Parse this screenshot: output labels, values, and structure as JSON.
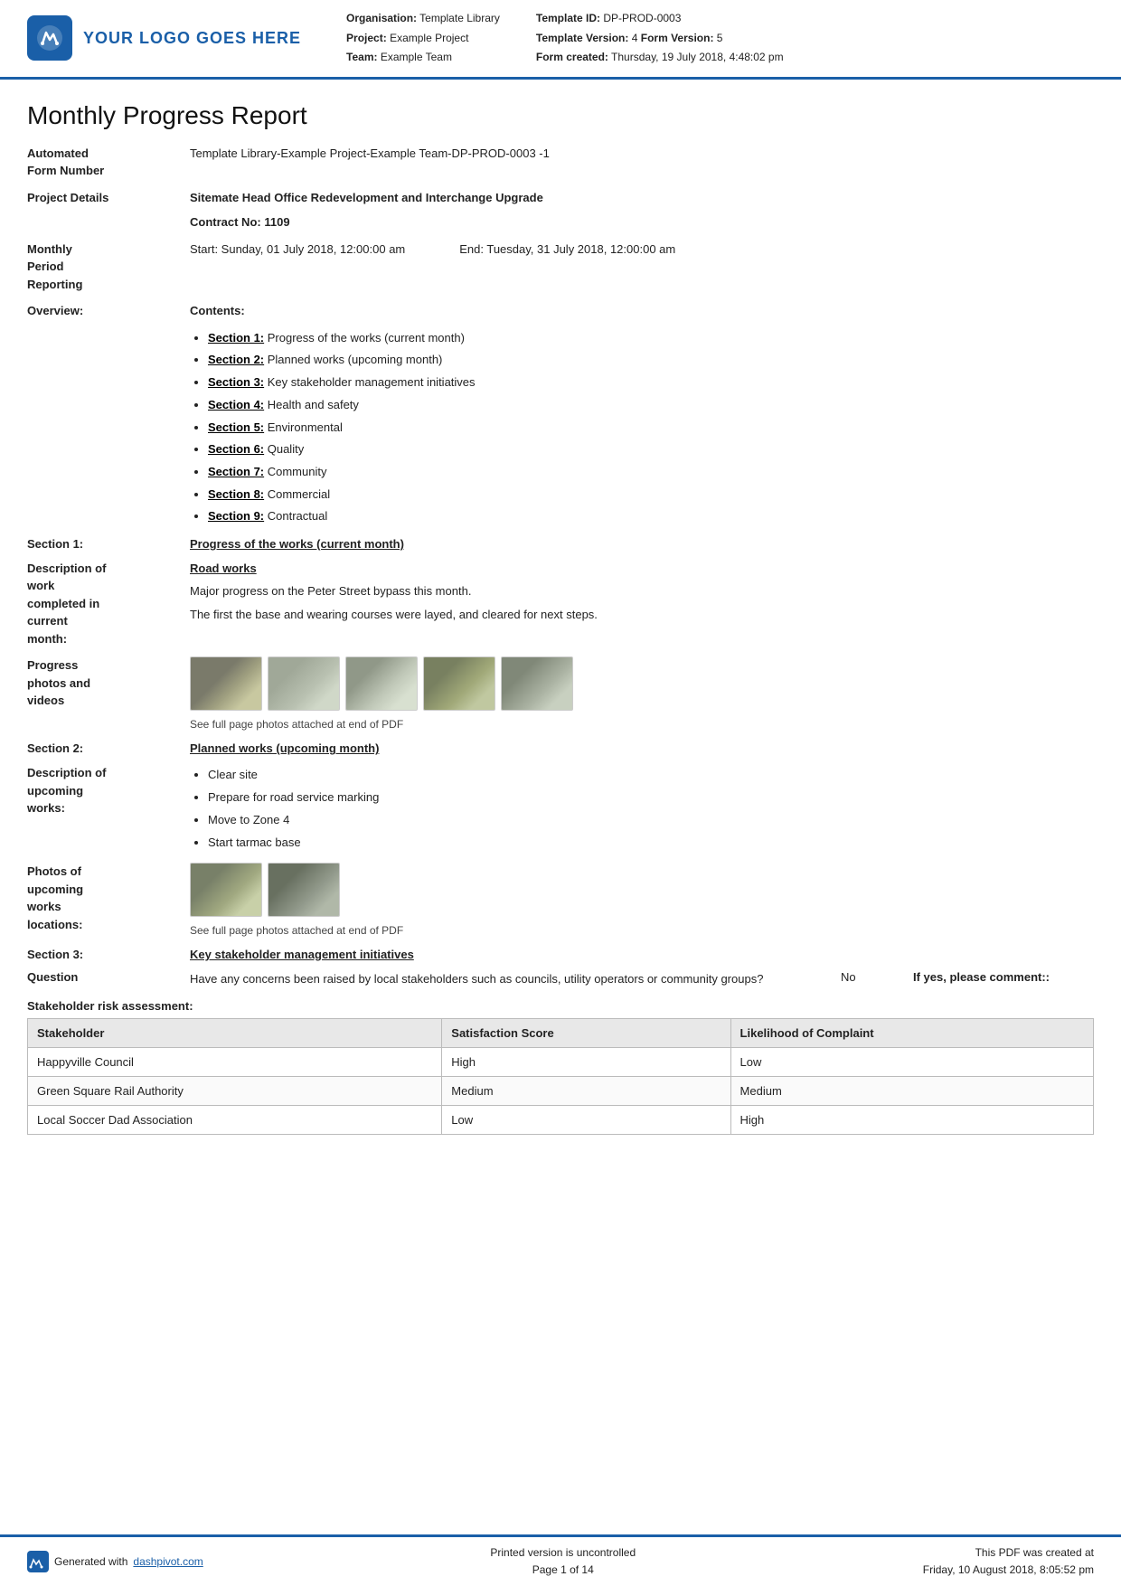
{
  "header": {
    "logo_text": "YOUR LOGO GOES HERE",
    "org_label": "Organisation:",
    "org_value": "Template Library",
    "project_label": "Project:",
    "project_value": "Example Project",
    "team_label": "Team:",
    "team_value": "Example Team",
    "template_id_label": "Template ID:",
    "template_id_value": "DP-PROD-0003",
    "template_version_label": "Template Version:",
    "template_version_value": "4",
    "form_version_label": "Form Version:",
    "form_version_value": "5",
    "form_created_label": "Form created:",
    "form_created_value": "Thursday, 19 July 2018, 4:48:02 pm"
  },
  "report": {
    "title": "Monthly Progress Report",
    "form_number_label": "Automated\nForm Number",
    "form_number_value": "Template Library-Example Project-Example Team-DP-PROD-0003   -1",
    "project_details_label": "Project Details",
    "project_details_value": "Sitemate Head Office Redevelopment and Interchange Upgrade",
    "contract_label": "Contract No:",
    "contract_value": "1109",
    "monthly_period_label": "Monthly\nPeriod\nReporting",
    "period_start": "Start: Sunday, 01 July 2018, 12:00:00 am",
    "period_end": "End: Tuesday, 31 July 2018, 12:00:00 am",
    "overview_label": "Overview:",
    "contents_label": "Contents:",
    "contents_items": [
      {
        "link": "Section 1:",
        "text": " Progress of the works (current month)"
      },
      {
        "link": "Section 2:",
        "text": " Planned works (upcoming month)"
      },
      {
        "link": "Section 3:",
        "text": " Key stakeholder management initiatives"
      },
      {
        "link": "Section 4:",
        "text": " Health and safety"
      },
      {
        "link": "Section 5:",
        "text": " Environmental"
      },
      {
        "link": "Section 6:",
        "text": " Quality"
      },
      {
        "link": "Section 7:",
        "text": " Community"
      },
      {
        "link": "Section 8:",
        "text": " Commercial"
      },
      {
        "link": "Section 9:",
        "text": " Contractual"
      }
    ],
    "section1_label": "Section 1:",
    "section1_title": "Progress of the works (current month)",
    "desc_work_label": "Description of\nwork\ncompleted in\ncurrent\nmonth:",
    "desc_work_heading": "Road works",
    "desc_work_line1": "Major progress on the Peter Street bypass this month.",
    "desc_work_line2": "The first the base and wearing courses were layed, and cleared for next steps.",
    "photos_label": "Progress\nphotos and\nvideos",
    "photos_caption": "See full page photos attached at end of PDF",
    "section2_label": "Section 2:",
    "section2_title": "Planned works (upcoming month)",
    "upcoming_works_label": "Description of\nupcoming\nworks:",
    "upcoming_works_items": [
      "Clear site",
      "Prepare for road service marking",
      "Move to Zone 4",
      "Start tarmac base"
    ],
    "upcoming_photos_label": "Photos of\nupcoming\nworks\nlocations:",
    "upcoming_photos_caption": "See full page photos attached at end of PDF",
    "section3_label": "Section 3:",
    "section3_title": "Key stakeholder management initiatives",
    "question_label": "Question",
    "question_text": "Have any concerns been raised by local stakeholders such as councils, utility operators or community groups?",
    "question_answer": "No",
    "question_comment": "If yes, please comment::",
    "stakeholder_section_title": "Stakeholder risk assessment:",
    "stakeholder_table": {
      "headers": [
        "Stakeholder",
        "Satisfaction Score",
        "Likelihood of Complaint"
      ],
      "rows": [
        [
          "Happyville Council",
          "High",
          "Low"
        ],
        [
          "Green Square Rail Authority",
          "Medium",
          "Medium"
        ],
        [
          "Local Soccer Dad Association",
          "Low",
          "High"
        ]
      ]
    }
  },
  "footer": {
    "generated_text": "Generated with ",
    "link_text": "dashpivot.com",
    "center_line1": "Printed version is uncontrolled",
    "center_line2": "Page 1 of 14",
    "right_line1": "This PDF was created at",
    "right_line2": "Friday, 10 August 2018, 8:05:52 pm"
  }
}
